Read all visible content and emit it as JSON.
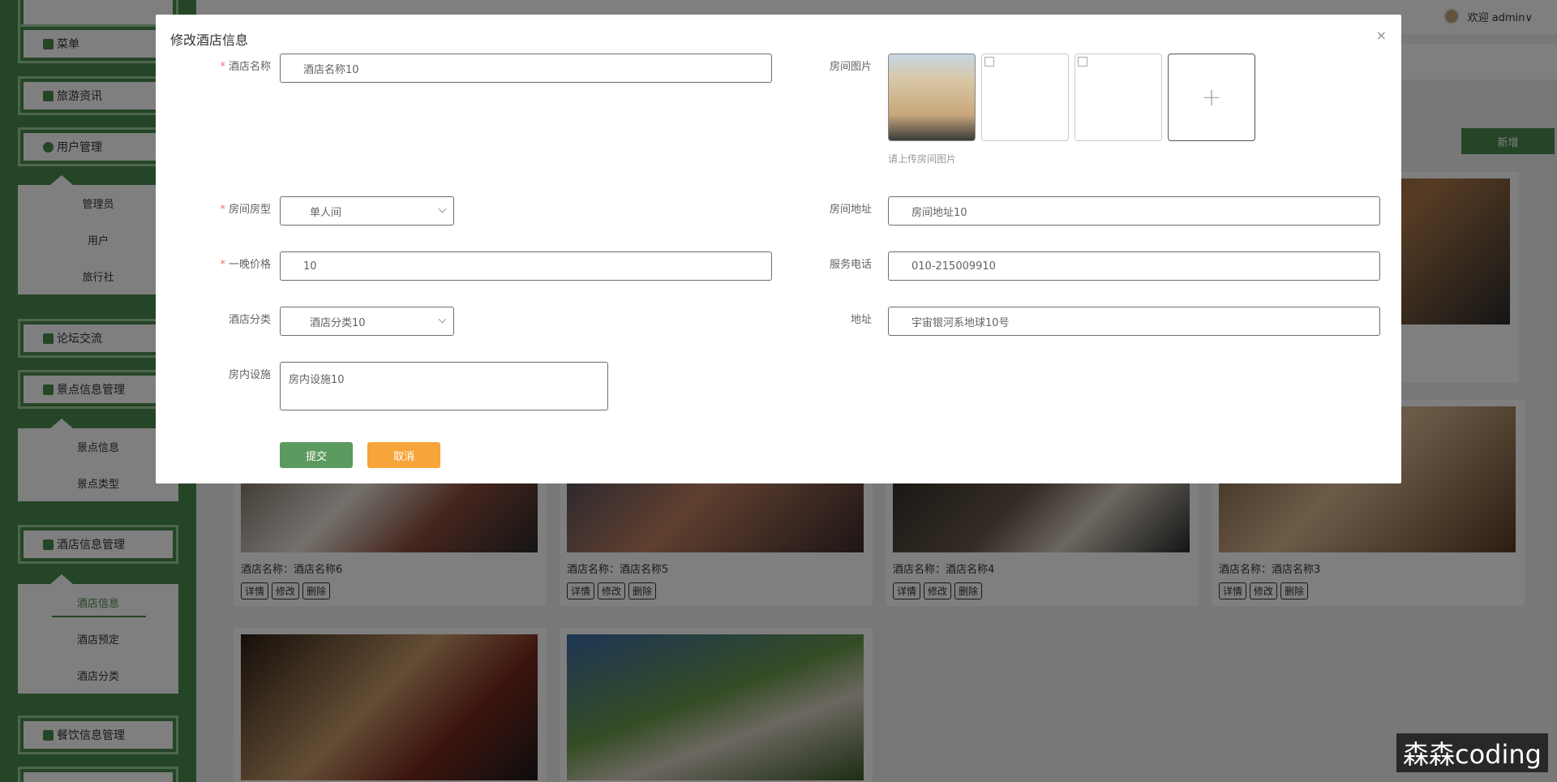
{
  "sidebar": {
    "menu": [
      {
        "label": "菜单"
      },
      {
        "label": "旅游资讯"
      },
      {
        "label": "用户管理"
      },
      {
        "label": "论坛交流"
      },
      {
        "label": "景点信息管理"
      },
      {
        "label": "酒店信息管理"
      },
      {
        "label": "餐饮信息管理"
      }
    ],
    "user_sub": [
      "管理员",
      "用户",
      "旅行社"
    ],
    "scenic_sub": [
      "景点信息",
      "景点类型"
    ],
    "hotel_sub": [
      "酒店信息",
      "酒店预定",
      "酒店分类"
    ]
  },
  "topbar": {
    "welcome": "欢迎 admin∨"
  },
  "main": {
    "add_label": "新增",
    "cards": [
      {
        "caption": "酒店名称：酒店名称6"
      },
      {
        "caption": "酒店名称：酒店名称5"
      },
      {
        "caption": "酒店名称：酒店名称4"
      },
      {
        "caption": "酒店名称：酒店名称3"
      }
    ],
    "ops": {
      "detail": "详情",
      "edit": "修改",
      "delete": "删除"
    }
  },
  "dialog": {
    "title": "修改酒店信息",
    "close": "×",
    "fields": {
      "hotel_name": {
        "label": "酒店名称",
        "value": "酒店名称10"
      },
      "room_images": {
        "label": "房间图片",
        "hint": "请上传房间图片"
      },
      "room_type": {
        "label": "房间房型",
        "value": "单人间"
      },
      "room_address": {
        "label": "房间地址",
        "value": "房间地址10"
      },
      "price": {
        "label": "一晚价格",
        "value": "10"
      },
      "phone": {
        "label": "服务电话",
        "value": "010-215009910"
      },
      "category": {
        "label": "酒店分类",
        "value": "酒店分类10"
      },
      "address": {
        "label": "地址",
        "value": "宇宙银河系地球10号"
      },
      "facilities": {
        "label": "房内设施",
        "value": "房内设施10"
      }
    },
    "upload_plus": "+",
    "submit": "提交",
    "cancel": "取消"
  },
  "watermark": "森森coding"
}
